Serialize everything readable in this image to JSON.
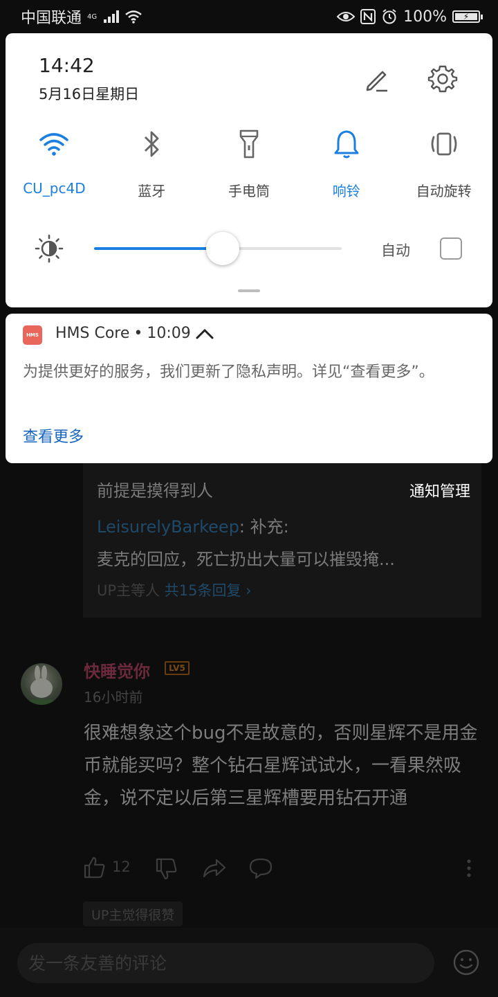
{
  "status_bar": {
    "carrier": "中国联通",
    "network_type": "4G",
    "battery_percent": "100%",
    "icons": [
      "signal-icon",
      "wifi-icon",
      "eye-icon",
      "nfc-icon",
      "alarm-icon",
      "battery-icon"
    ]
  },
  "quick_settings": {
    "time": "14:42",
    "date": "5月16日星期日",
    "tiles": [
      {
        "icon": "wifi-icon",
        "label": "CU_pc4D",
        "active": true
      },
      {
        "icon": "bluetooth-icon",
        "label": "蓝牙",
        "active": false
      },
      {
        "icon": "flashlight-icon",
        "label": "手电筒",
        "active": false
      },
      {
        "icon": "bell-icon",
        "label": "响铃",
        "active": true
      },
      {
        "icon": "auto-rotate-icon",
        "label": "自动旋转",
        "active": false
      }
    ],
    "brightness": {
      "level": 0.52,
      "auto_label": "自动",
      "auto_checked": false
    },
    "accent_color": "#1a7fe0"
  },
  "notification": {
    "app_icon_text": "HMS",
    "app_name": "HMS Core",
    "separator": "•",
    "time": "10:09",
    "body": "为提供更好的服务，我们更新了隐私声明。详见“查看更多”。",
    "action": "查看更多",
    "icon_color": "#e8665a"
  },
  "notification_management": "通知管理",
  "background": {
    "reply_box": {
      "line1": "前提是摸得到人",
      "user": "LeisurelyBarkeep",
      "user_sep": ": ",
      "reply_prefix": "补充:",
      "line3": "麦克的回应，死亡扔出大量可以摧毁掩...",
      "more_prefix": "UP主等人 ",
      "more_count": "共15条回复",
      "more_chevron": "›"
    },
    "comment": {
      "username": "快睡觉你",
      "level": "LV5",
      "time": "16小时前",
      "text": "很难想象这个bug不是故意的，否则星辉不是用金币就能买吗？整个钻石星辉试试水，一看果然吸金，说不定以后第三星辉槽要用钻石开通",
      "like_count": "12",
      "up_badge": "UP主觉得很赞"
    },
    "input_placeholder": "发一条友善的评论"
  }
}
